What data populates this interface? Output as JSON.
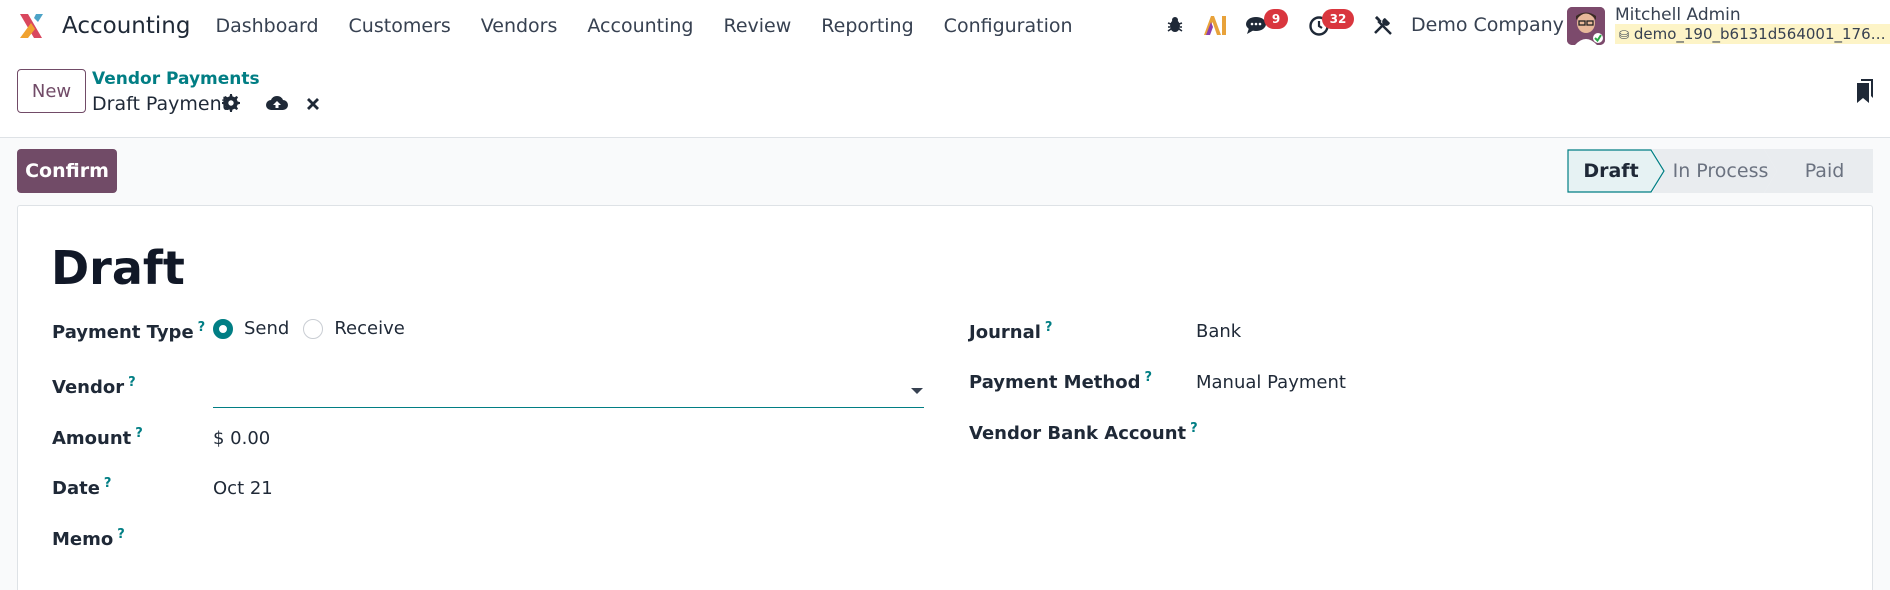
{
  "navbar": {
    "app_name": "Accounting",
    "menu": [
      "Dashboard",
      "Customers",
      "Vendors",
      "Accounting",
      "Review",
      "Reporting",
      "Configuration"
    ],
    "messages_badge": "9",
    "activities_badge": "32",
    "company": "Demo Company",
    "user_name": "Mitchell Admin",
    "database": "demo_190_b6131d564001_1761..."
  },
  "control_panel": {
    "new_label": "New",
    "breadcrumb_parent": "Vendor Payments",
    "record_name": "Draft Payment"
  },
  "statusbar": {
    "confirm_label": "Confirm",
    "stages": [
      "Draft",
      "In Process",
      "Paid"
    ],
    "current_stage": "Draft"
  },
  "form": {
    "title": "Draft",
    "help_mark": "?",
    "payment_type": {
      "label": "Payment Type",
      "options": [
        "Send",
        "Receive"
      ],
      "selected": "Send"
    },
    "vendor": {
      "label": "Vendor",
      "value": ""
    },
    "amount": {
      "label": "Amount",
      "value": "$ 0.00"
    },
    "date": {
      "label": "Date",
      "value": "Oct 21"
    },
    "memo": {
      "label": "Memo",
      "value": ""
    },
    "journal": {
      "label": "Journal",
      "value": "Bank"
    },
    "payment_method": {
      "label": "Payment Method",
      "value": "Manual Payment"
    },
    "vendor_bank_account": {
      "label": "Vendor Bank Account",
      "value": ""
    }
  },
  "colors": {
    "brand": "#714b67",
    "accent": "#017e84",
    "badge": "#d9363e"
  },
  "icons": [
    "app-logo-icon",
    "bug-icon",
    "ai-icon",
    "chat-icon",
    "clock-icon",
    "tools-icon",
    "gear-icon",
    "cloud-upload-icon",
    "close-icon",
    "bookmark-icon",
    "database-icon"
  ]
}
